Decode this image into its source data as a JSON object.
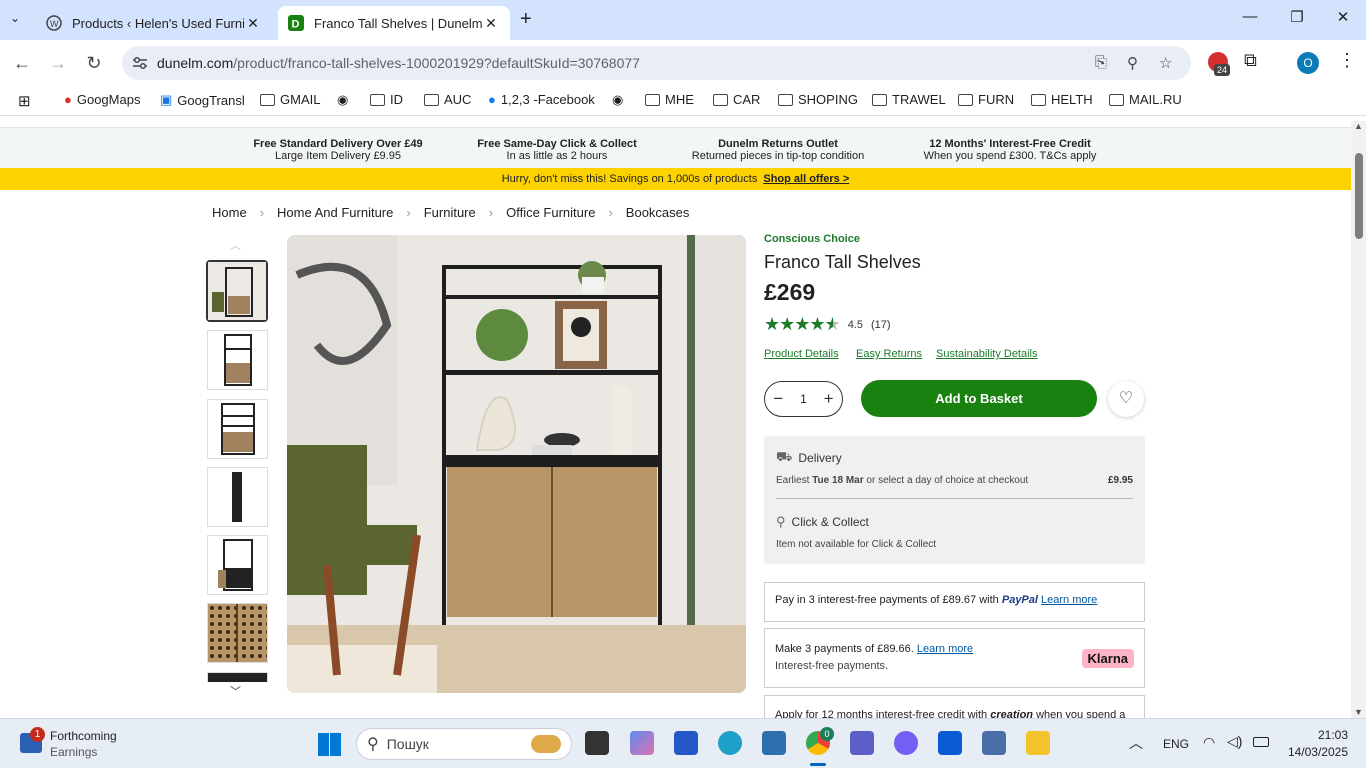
{
  "browser": {
    "tabs": [
      {
        "title": "Products ‹ Helen's Used Furnitu",
        "active": false
      },
      {
        "title": "Franco Tall Shelves | Dunelm",
        "active": true
      }
    ],
    "url_host": "dunelm.com",
    "url_path": "/product/franco-tall-shelves-1000201929?defaultSkuId=30768077",
    "extension_badge": "24",
    "profile_initial": "O",
    "bookmarks": [
      "GoogMaps",
      "GoogTransl",
      "GMAIL",
      "ID",
      "AUC",
      "1,2,3 -Facebook",
      "MHE",
      "CAR",
      "SHOPING",
      "TRAWEL",
      "FURN",
      "HELTH",
      "MAIL.RU"
    ]
  },
  "usp": [
    {
      "title": "Free Standard Delivery Over £49",
      "sub": "Large Item Delivery £9.95"
    },
    {
      "title": "Free Same-Day Click & Collect",
      "sub": "In as little as 2 hours"
    },
    {
      "title": "Dunelm Returns Outlet",
      "sub": "Returned pieces in tip-top condition"
    },
    {
      "title": "12 Months' Interest-Free Credit",
      "sub": "When you spend £300. T&Cs apply"
    }
  ],
  "promo": {
    "text": "Hurry, don't miss this! Savings on 1,000s of products",
    "link": "Shop all offers >"
  },
  "breadcrumb": [
    "Home",
    "Home And Furniture",
    "Furniture",
    "Office Furniture",
    "Bookcases"
  ],
  "product": {
    "badge": "Conscious Choice",
    "title": "Franco Tall Shelves",
    "price": "£269",
    "rating_value": "4.5",
    "rating_count": "(17)",
    "rating_stars": 4.5,
    "links": [
      "Product Details",
      "Easy Returns",
      "Sustainability Details"
    ],
    "quantity": "1",
    "add_label": "Add to Basket"
  },
  "fulfilment": {
    "delivery_title": "Delivery",
    "delivery_prefix": "Earliest",
    "delivery_date": "Tue 18 Mar",
    "delivery_suffix": "or select a day of choice at checkout",
    "delivery_price": "£9.95",
    "collect_title": "Click & Collect",
    "collect_text": "Item not available for Click & Collect"
  },
  "payments": {
    "paypal_text": "Pay in 3 interest-free payments of £89.67 with",
    "paypal_brand": "PayPal",
    "paypal_link": "Learn more",
    "klarna_text": "Make 3 payments of £89.66.",
    "klarna_link": "Learn more",
    "klarna_sub": "Interest-free payments.",
    "klarna_brand": "Klarna",
    "creation_text_a": "Apply for 12 months interest-free credit with",
    "creation_brand": "creation",
    "creation_text_b": "when you spend a"
  },
  "taskbar": {
    "notif_count": "1",
    "widget_title": "Forthcoming",
    "widget_sub": "Earnings",
    "search_placeholder": "Пошук",
    "edge_badge": "0",
    "lang": "ENG",
    "time": "21:03",
    "date": "14/03/2025"
  }
}
